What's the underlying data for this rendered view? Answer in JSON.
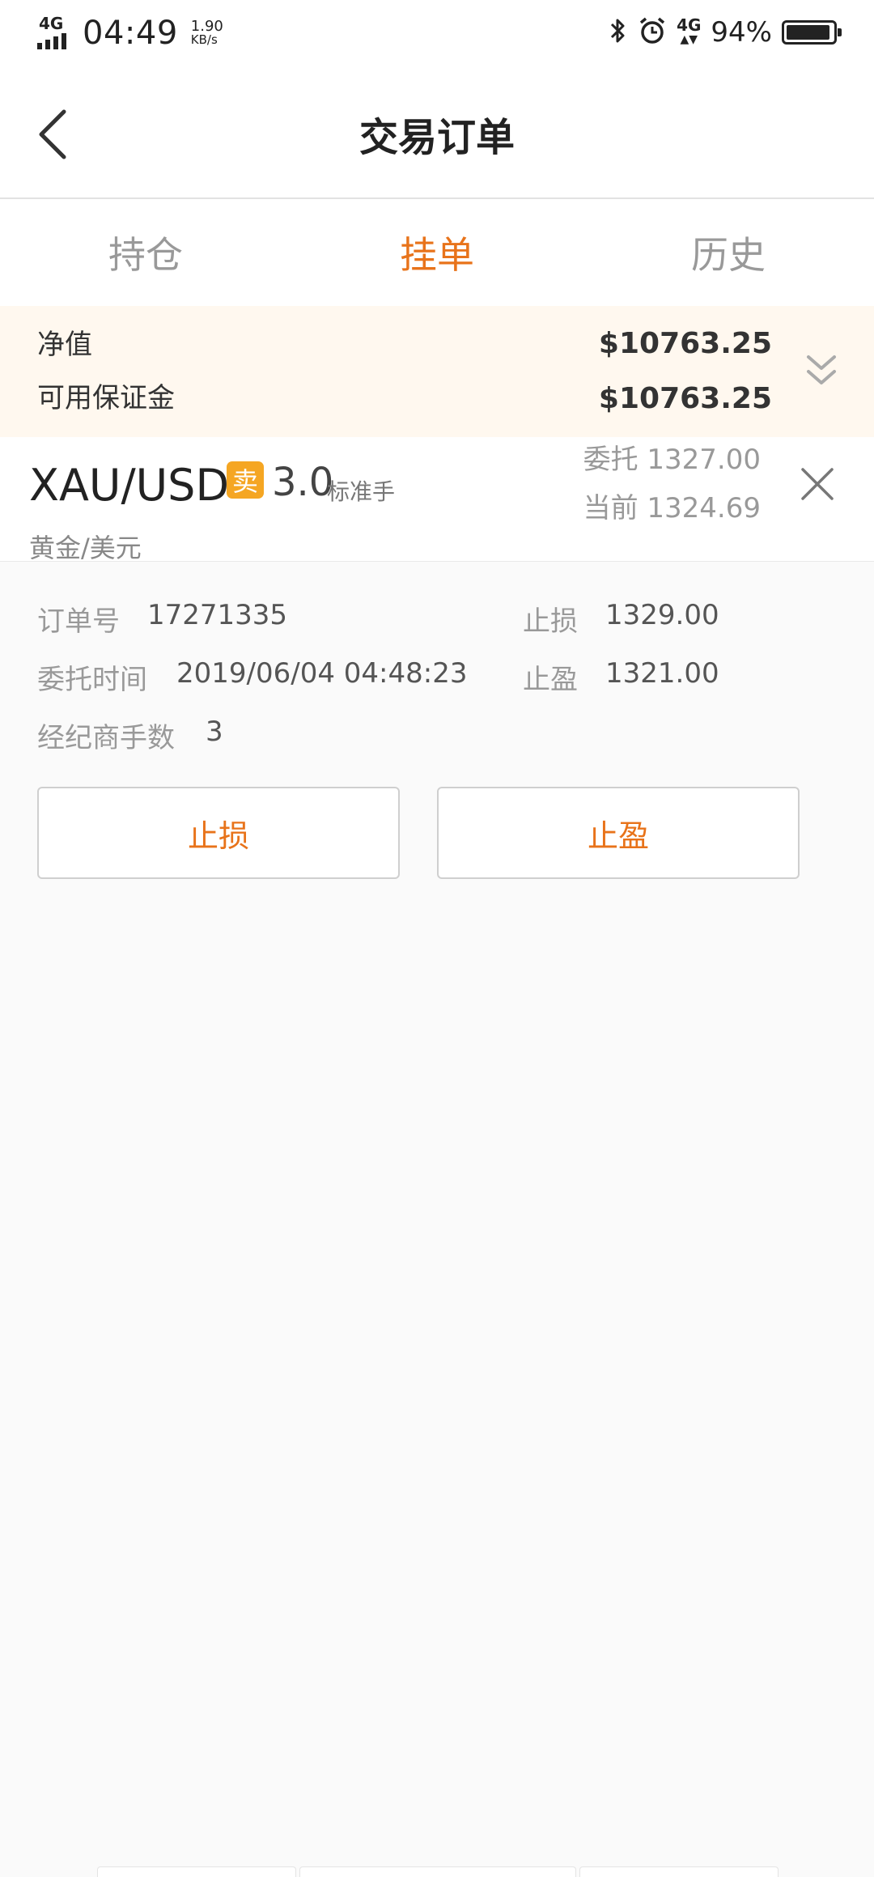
{
  "status_bar": {
    "network": "4G",
    "time": "04:49",
    "speed_value": "1.90",
    "speed_unit": "KB/s",
    "network_right": "4G",
    "battery_pct": "94%",
    "battery_level": 0.94
  },
  "nav": {
    "title": "交易订单"
  },
  "tabs": [
    {
      "label": "持仓",
      "active": false
    },
    {
      "label": "挂单",
      "active": true
    },
    {
      "label": "历史",
      "active": false
    }
  ],
  "summary": {
    "net_value_label": "净值",
    "net_value": "$10763.25",
    "margin_label": "可用保证金",
    "margin_value": "$10763.25"
  },
  "order": {
    "symbol": "XAU/USD",
    "side": "卖",
    "lots": "3.0",
    "lot_unit": "标准手",
    "symbol_name": "黄金/美元",
    "entrust_price": "委托 1327.00",
    "current_price": "当前 1324.69",
    "order_no_label": "订单号",
    "order_no": "17271335",
    "time_label": "委托时间",
    "time_value": "2019/06/04 04:48:23",
    "broker_lots_label": "经纪商手数",
    "broker_lots": "3",
    "stop_loss_label": "止损",
    "stop_loss": "1329.00",
    "take_profit_label": "止盈",
    "take_profit": "1321.00"
  },
  "actions": {
    "stop_loss_button": "止损",
    "take_profit_button": "止盈"
  },
  "colors": {
    "accent": "#e8731a",
    "badge": "#f5a623",
    "summary_bg": "#fff8ef"
  }
}
